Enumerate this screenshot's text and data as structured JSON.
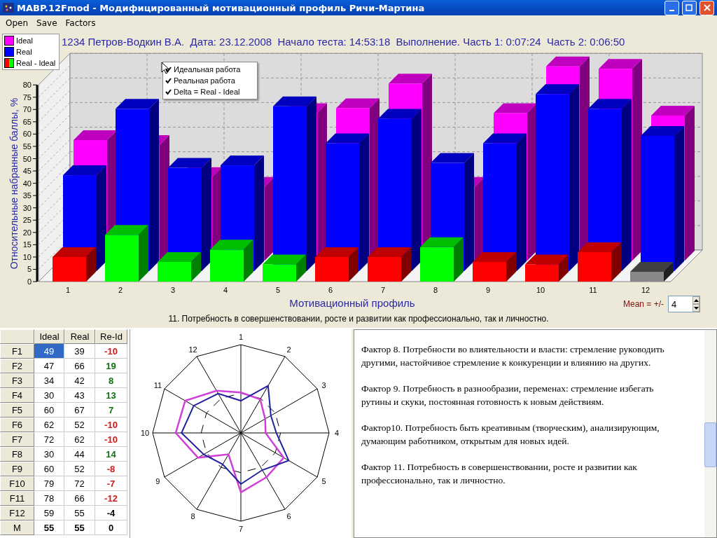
{
  "window": {
    "title": "MABP.12Fmod - Модифицированный мотивационный профиль Ричи-Мартина"
  },
  "menu": [
    {
      "label": "Open"
    },
    {
      "label": "Save"
    },
    {
      "label": "Factors"
    }
  ],
  "legend": [
    {
      "label": "Ideal",
      "swatch": [
        {
          "color": "#ff00ff"
        }
      ]
    },
    {
      "label": "Real",
      "swatch": [
        {
          "color": "#0000ff"
        }
      ]
    },
    {
      "label": "Real - Ideal",
      "swatch": [
        {
          "color": "#ff0000"
        },
        {
          "color": "#00ff00"
        }
      ]
    }
  ],
  "header": "1234 Петров-Водкин В.А.  Дата: 23.12.2008  Начало теста: 14:53:18  Выполнение. Часть 1: 0:07:24  Часть 2: 0:06:50",
  "popup_menu": [
    {
      "label": "Идеальная работа",
      "checked": true
    },
    {
      "label": "Реальная работа",
      "checked": true
    },
    {
      "label": "Delta = Real - Ideal",
      "checked": true
    }
  ],
  "bar_chart": {
    "xlabel": "Мотивационный профиль",
    "ylabel": "Относительные набранные баллы, %",
    "categories": [
      "1",
      "2",
      "3",
      "4",
      "5",
      "6",
      "7",
      "8",
      "9",
      "10",
      "11",
      "12"
    ],
    "yticks": [
      "80",
      "75",
      "70",
      "65",
      "60",
      "55",
      "50",
      "45",
      "40",
      "35",
      "30",
      "25",
      "20",
      "15",
      "10",
      "5",
      "0"
    ]
  },
  "mean": {
    "label": "Mean = +/-",
    "value": "4"
  },
  "caption": "11. Потребность в совершенствовании, росте и развитии как профессионально, так и личностно.",
  "table": {
    "columns": [
      "Ideal",
      "Real",
      "Re-Id"
    ],
    "rows": [
      {
        "label": "F1",
        "ideal": "49",
        "real": "39",
        "delta": "-10",
        "kind": "factor",
        "selected": true
      },
      {
        "label": "F2",
        "ideal": "47",
        "real": "66",
        "delta": "19",
        "kind": "factor",
        "selected": false
      },
      {
        "label": "F3",
        "ideal": "34",
        "real": "42",
        "delta": "8",
        "kind": "factor",
        "selected": false
      },
      {
        "label": "F4",
        "ideal": "30",
        "real": "43",
        "delta": "13",
        "kind": "factor",
        "selected": false
      },
      {
        "label": "F5",
        "ideal": "60",
        "real": "67",
        "delta": "7",
        "kind": "factor",
        "selected": false
      },
      {
        "label": "F6",
        "ideal": "62",
        "real": "52",
        "delta": "-10",
        "kind": "factor",
        "selected": false
      },
      {
        "label": "F7",
        "ideal": "72",
        "real": "62",
        "delta": "-10",
        "kind": "factor",
        "selected": false
      },
      {
        "label": "F8",
        "ideal": "30",
        "real": "44",
        "delta": "14",
        "kind": "factor",
        "selected": false
      },
      {
        "label": "F9",
        "ideal": "60",
        "real": "52",
        "delta": "-8",
        "kind": "factor",
        "selected": false
      },
      {
        "label": "F10",
        "ideal": "79",
        "real": "72",
        "delta": "-7",
        "kind": "factor",
        "selected": false
      },
      {
        "label": "F11",
        "ideal": "78",
        "real": "66",
        "delta": "-12",
        "kind": "factor",
        "selected": false
      },
      {
        "label": "F12",
        "ideal": "59",
        "real": "55",
        "delta": "-4",
        "kind": "factor",
        "selected": false
      },
      {
        "label": "M",
        "ideal": "55",
        "real": "55",
        "delta": "0",
        "kind": "mean",
        "selected": false
      }
    ]
  },
  "radar": {
    "labels": [
      "1",
      "2",
      "3",
      "4",
      "5",
      "6",
      "7",
      "8",
      "9",
      "10",
      "11",
      "12"
    ]
  },
  "description": [
    "Фактор 8. Потребности во влиятельности и власти: стремление руководить другими, настойчивое стремление к конкуренции и влиянию на других.",
    "Фактор 9. Потребность в разнообразии, переменах: стремление избегать рутины и скуки, постоянная готовность к новым действиям.",
    "Фактор10. Потребность быть креативным (творческим), анализирующим, думающим работником, открытым для новых идей.",
    "Фактор 11. Потребность в совершенствовании, росте и развитии как профессионально, так и личностно."
  ]
}
